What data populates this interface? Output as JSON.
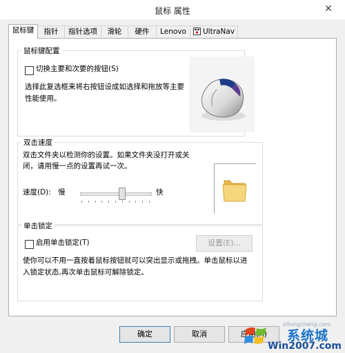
{
  "window": {
    "title": "鼠标 属性",
    "close_glyph": "✕"
  },
  "tabs": [
    {
      "label": "鼠标键",
      "active": true
    },
    {
      "label": "指针",
      "active": false
    },
    {
      "label": "指针选项",
      "active": false
    },
    {
      "label": "滑轮",
      "active": false
    },
    {
      "label": "硬件",
      "active": false
    },
    {
      "label": "Lenovo",
      "active": false
    },
    {
      "label": "UltraNav",
      "active": false,
      "icon": "ultranav-trackpoint-icon"
    }
  ],
  "button_config": {
    "label": "鼠标键配置",
    "switch_checkbox_label": "切换主要和次要的按钮(S)",
    "switch_checked": false,
    "description_line1": "选择此复选框来将右按钮设成如选择和拖放等主要",
    "description_line2": "性能使用。",
    "preview_icon": "mouse-icon"
  },
  "double_click": {
    "label": "双击速度",
    "description_line1": "双击文件夹以检测你的设置。如果文件夹没打开或关",
    "description_line2": "闭，请用慢一点的设置再试一次。",
    "speed_label": "速度(D):",
    "slow_label": "慢",
    "fast_label": "快",
    "speed_level": 0.6,
    "test_icon": "folder-icon"
  },
  "click_lock": {
    "label": "单击锁定",
    "enable_checkbox_label": "启用单击锁定(T)",
    "enable_checked": false,
    "settings_button": "设置(E)...",
    "description_line1": "使你可以不用一直按着鼠标按钮就可以突出显示或拖拽。单击鼠标以进",
    "description_line2": "入锁定状态,再次单击鼠标可解除锁定。"
  },
  "footer": {
    "ok_label": "确定",
    "cancel_label": "取消",
    "apply_label": "应用(A)"
  },
  "watermark": {
    "site": "xitongcheng.com",
    "logo_text": "系统城",
    "brand": "Win2007.com"
  }
}
